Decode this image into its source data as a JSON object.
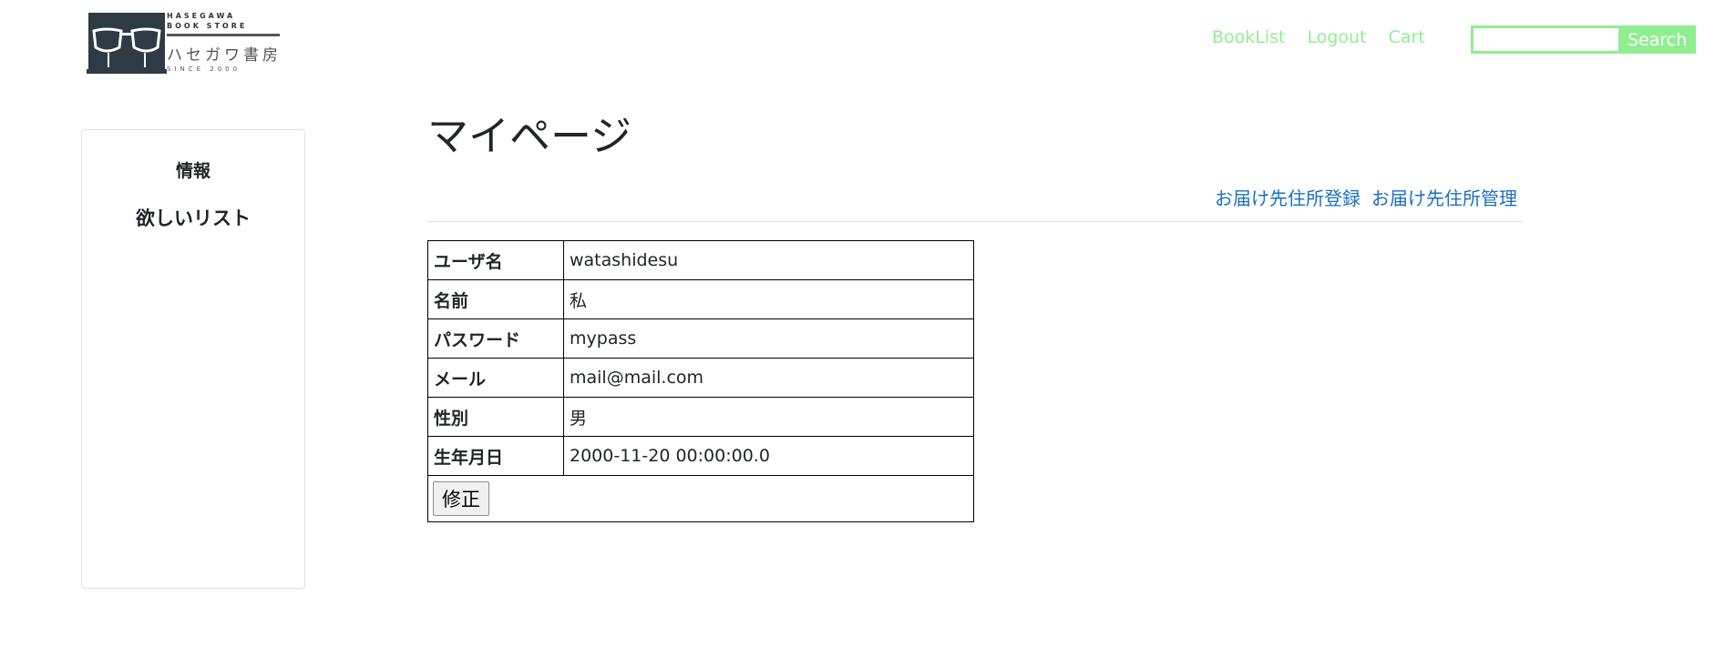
{
  "logo": {
    "line1": "HASEGAWA",
    "line2": "BOOK STORE",
    "jp": "ハセガワ書房",
    "since": "SINCE 2000"
  },
  "nav": {
    "booklist": "BookList",
    "logout": "Logout",
    "cart": "Cart"
  },
  "search": {
    "value": "",
    "button": "Search"
  },
  "sidebar": {
    "items": [
      "情報",
      "欲しいリスト"
    ]
  },
  "main": {
    "title": "マイページ",
    "links": [
      "お届け先住所登録",
      "お届け先住所管理"
    ]
  },
  "profile": {
    "rows": [
      {
        "key": "ユーザ名",
        "value": "watashidesu"
      },
      {
        "key": "名前",
        "value": "私"
      },
      {
        "key": "パスワード",
        "value": "mypass"
      },
      {
        "key": "メール",
        "value": "mail@mail.com"
      },
      {
        "key": "性別",
        "value": "男"
      },
      {
        "key": "生年月日",
        "value": "2000-11-20 00:00:00.0"
      }
    ],
    "edit_button": "修正"
  },
  "colors": {
    "nav_green": "#90ee90",
    "link_blue": "#1a6fc4",
    "logo_dark": "#2f3b44"
  }
}
